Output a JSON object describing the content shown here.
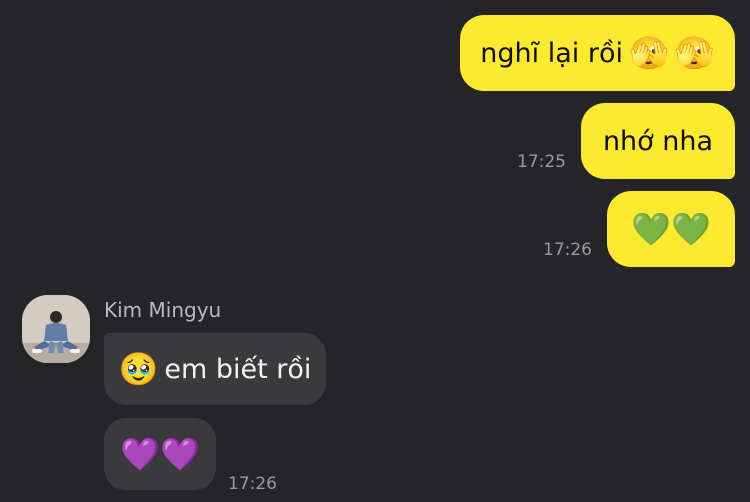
{
  "messages": {
    "m1": {
      "text": "nghĩ lại rồi",
      "emoji1": "🫣",
      "emoji2": "🫣"
    },
    "m2": {
      "text": "nhớ nha",
      "time": "17:25"
    },
    "m3": {
      "emoji1": "💚",
      "emoji2": "💚",
      "time": "17:26"
    },
    "m4": {
      "emoji": "🥹",
      "text": "em biết rồi"
    },
    "m5": {
      "emoji1": "💜",
      "emoji2": "💜",
      "time": "17:26"
    }
  },
  "contact": {
    "name": "Kim Mingyu",
    "avatar_icon": "user-photo"
  },
  "colors": {
    "background": "#252528",
    "outgoing_bubble": "#fde930",
    "incoming_bubble": "#3a3a3d",
    "timestamp": "#9a9a9e"
  }
}
